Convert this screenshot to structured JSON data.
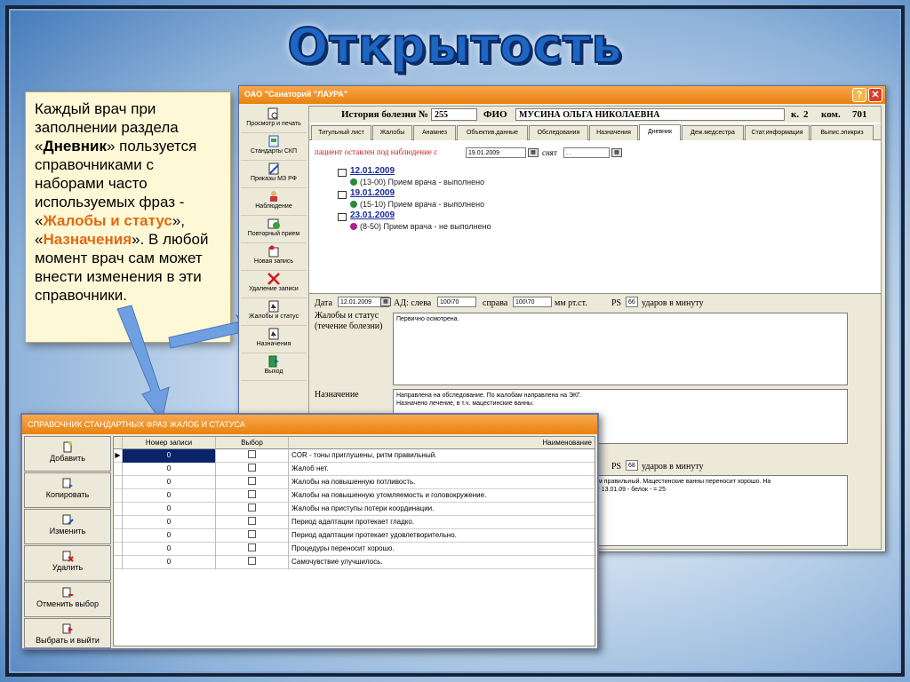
{
  "slide": {
    "title": "Открытость",
    "callout": {
      "t1": "Каждый врач при заполнении раздела «",
      "b1": "Дневник",
      "t2": "» пользуется справочниками с наборами часто используемых фраз - «",
      "o1": "Жалобы и статус",
      "t3": "», «",
      "o2": "Назначения",
      "t4": "». В любой момент врач сам может внести изменения в эти справочники."
    }
  },
  "colors": {
    "accent": "#e8820e",
    "title": "#1d66c4",
    "callout_bg": "#fff8d6",
    "link": "#1b2a9c",
    "red_text": "#c0221d"
  },
  "window": {
    "title": "ОАО \"Санаторий \"ЛАУРА\"",
    "help": "?",
    "close": "✕",
    "sidebar": [
      {
        "label": "Просмотр и печать",
        "icon": "print-preview-icon"
      },
      {
        "label": "Стандарты СКП",
        "icon": "standards-icon"
      },
      {
        "label": "Приказы МЗ РФ",
        "icon": "orders-icon"
      },
      {
        "label": "Наблюдение",
        "icon": "observation-icon"
      },
      {
        "label": "Повторный прием",
        "icon": "repeat-visit-icon"
      },
      {
        "label": "Новая запись",
        "icon": "new-record-icon"
      },
      {
        "label": "Удаление записи",
        "icon": "delete-record-icon"
      },
      {
        "label": "Жалобы и статус",
        "icon": "complaints-icon"
      },
      {
        "label": "Назначения",
        "icon": "prescriptions-icon"
      },
      {
        "label": "Выход",
        "icon": "exit-icon"
      }
    ],
    "header": {
      "history_label": "История болезни №",
      "history_no": "255",
      "fio_label": "ФИО",
      "fio": "МУСИНА ОЛЬГА НИКОЛАЕВНА",
      "k_label": "к.",
      "k": "2",
      "kom_label": "ком.",
      "kom": "701"
    },
    "tabs": [
      "Титульный лист",
      "Жалобы",
      "Анамнез",
      "Объектив.данные",
      "Обследования",
      "Назначения",
      "Дневник",
      "Деж.медсестра",
      "Стат.информация",
      "Выпис.эпикриз"
    ],
    "active_tab": "Дневник",
    "status": {
      "label": "пациент оставлен под наблюдение с",
      "date": "19.01.2009",
      "removed_label": "снят",
      "removed_date": " .  ."
    },
    "diary": [
      {
        "date": "12.01.2009",
        "entry": "(13-00) Прием врача - выполнено",
        "status": "done"
      },
      {
        "date": "19.01.2009",
        "entry": "(15-10) Прием врача - выполнено",
        "status": "done"
      },
      {
        "date": "23.01.2009",
        "entry": "(8-50) Прием врача - не выполнено",
        "status": "pending"
      }
    ],
    "form": {
      "date_label": "Дата",
      "date": "12.01.2009",
      "ad_label": "АД: слева",
      "ad_left": "100\\70",
      "right_label": "справа",
      "ad_right": "100\\70",
      "unit": "мм рт.ст.",
      "ps_label": "PS",
      "ps": "66",
      "ps_unit": "ударов в минуту",
      "complaints_label": "Жалобы и статус (течение болезни)",
      "complaints_text": "Первично осмотрена.",
      "prescr_label": "Назначение",
      "prescr_text1": "Направлена на обследование. По жалобам направлена на ЭКГ.",
      "prescr_text2": "Назначено лечение, в т.ч. мацестинские ванны.",
      "ps2": "68",
      "ps2_unit": "ударов в минуту",
      "text2_line1": "ритм правильный.  Мацестинские ванны переносит хорошо.   На",
      "text2_line2": "и  от 13.01.09  - белок - = 25"
    }
  },
  "dialog": {
    "title": "СПРАВОЧНИК СТАНДАРТНЫХ ФРАЗ ЖАЛОБ И СТАТУСА",
    "buttons": [
      {
        "label": "Добавить",
        "icon": "add-icon"
      },
      {
        "label": "Копировать",
        "icon": "copy-icon"
      },
      {
        "label": "Изменить",
        "icon": "edit-icon"
      },
      {
        "label": "Удалить",
        "icon": "delete-icon"
      },
      {
        "label": "Отменить выбор",
        "icon": "deselect-icon"
      },
      {
        "label": "Выбрать и выйти",
        "icon": "select-exit-icon"
      }
    ],
    "columns": [
      "Номер записи",
      "Выбор",
      "Наименование"
    ],
    "rows": [
      {
        "no": "0",
        "name": "COR - тоны приглушены, ритм правильный."
      },
      {
        "no": "0",
        "name": "Жалоб нет."
      },
      {
        "no": "0",
        "name": "Жалобы на повышенную потливость."
      },
      {
        "no": "0",
        "name": "Жалобы на повышенную утомляемость и головокружение."
      },
      {
        "no": "0",
        "name": "Жалобы на приступы потери координации."
      },
      {
        "no": "0",
        "name": "Период адаптации протекает гладко."
      },
      {
        "no": "0",
        "name": "Период адаптации протекает удовлетворительно."
      },
      {
        "no": "0",
        "name": "Процедуры переносит хорошо."
      },
      {
        "no": "0",
        "name": "Самочувствие улучшилось."
      }
    ]
  }
}
